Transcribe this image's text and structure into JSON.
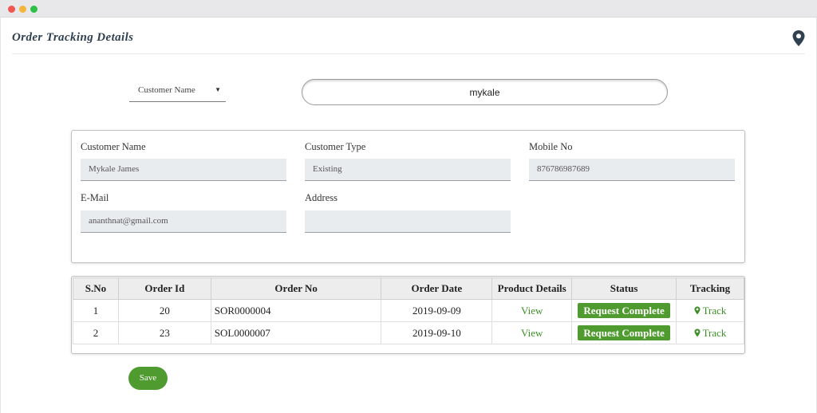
{
  "page": {
    "title": "Order Tracking Details"
  },
  "filter": {
    "selected": "Customer Name",
    "search_value": "mykale"
  },
  "customer": {
    "name_label": "Customer Name",
    "name_value": "Mykale James",
    "type_label": "Customer Type",
    "type_value": "Existing",
    "mobile_label": "Mobile No",
    "mobile_value": "876786987689",
    "email_label": "E-Mail",
    "email_value": "ananthnat@gmail.com",
    "address_label": "Address",
    "address_value": ""
  },
  "orders": {
    "headers": [
      "S.No",
      "Order Id",
      "Order No",
      "Order Date",
      "Product Details",
      "Status",
      "Tracking"
    ],
    "rows": [
      {
        "sno": "1",
        "order_id": "20",
        "order_no": "SOR0000004",
        "order_date": "2019-09-09",
        "product": "View",
        "status": "Request Complete",
        "tracking": "Track"
      },
      {
        "sno": "2",
        "order_id": "23",
        "order_no": "SOL0000007",
        "order_date": "2019-09-10",
        "product": "View",
        "status": "Request Complete",
        "tracking": "Track"
      }
    ]
  },
  "actions": {
    "save_label": "Save"
  },
  "icons": {
    "location": "map-pin-icon",
    "track": "map-marker-icon",
    "caret": "caret-down-icon"
  },
  "colors": {
    "accent_green": "#4f9b2f",
    "title_color": "#2f4050",
    "pin_color": "#2f4050"
  }
}
